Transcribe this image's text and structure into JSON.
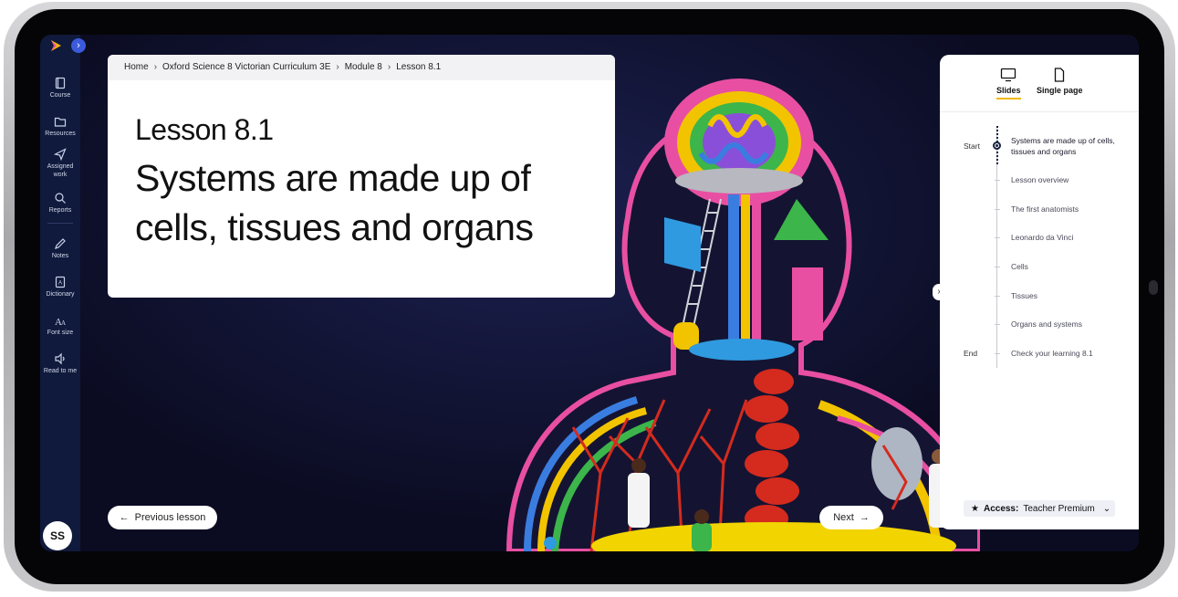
{
  "rail": {
    "items": [
      {
        "label": "Course",
        "icon": "book-icon"
      },
      {
        "label": "Resources",
        "icon": "folder-icon"
      },
      {
        "label": "Assigned work",
        "icon": "send-icon"
      },
      {
        "label": "Reports",
        "icon": "reports-icon"
      },
      {
        "label": "Notes",
        "icon": "pencil-icon"
      },
      {
        "label": "Dictionary",
        "icon": "dictionary-icon"
      },
      {
        "label": "Font size",
        "icon": "font-size-icon"
      },
      {
        "label": "Read to me",
        "icon": "speaker-icon"
      }
    ],
    "avatar_initials": "SS"
  },
  "breadcrumb": [
    "Home",
    "Oxford Science 8 Victorian Curriculum 3E",
    "Module 8",
    "Lesson 8.1"
  ],
  "lesson": {
    "number": "Lesson 8.1",
    "title": "Systems are made up of cells, tissues and organs"
  },
  "nav": {
    "previous_label": "Previous lesson",
    "next_label": "Next"
  },
  "panel": {
    "view_tabs": [
      {
        "label": "Slides",
        "active": true
      },
      {
        "label": "Single page",
        "active": false
      }
    ],
    "start_label": "Start",
    "end_label": "End",
    "slides": [
      "Systems are made up of cells, tissues and organs",
      "Lesson overview",
      "The first anatomists",
      "Leonardo da Vinci",
      "Cells",
      "Tissues",
      "Organs and systems",
      "Check your learning 8.1"
    ],
    "access_label": "Access:",
    "access_value": "Teacher Premium"
  },
  "colors": {
    "rail_bg": "#101a3c",
    "accent_tab": "#f2b705",
    "artwork_bg": "#0b0c22"
  }
}
